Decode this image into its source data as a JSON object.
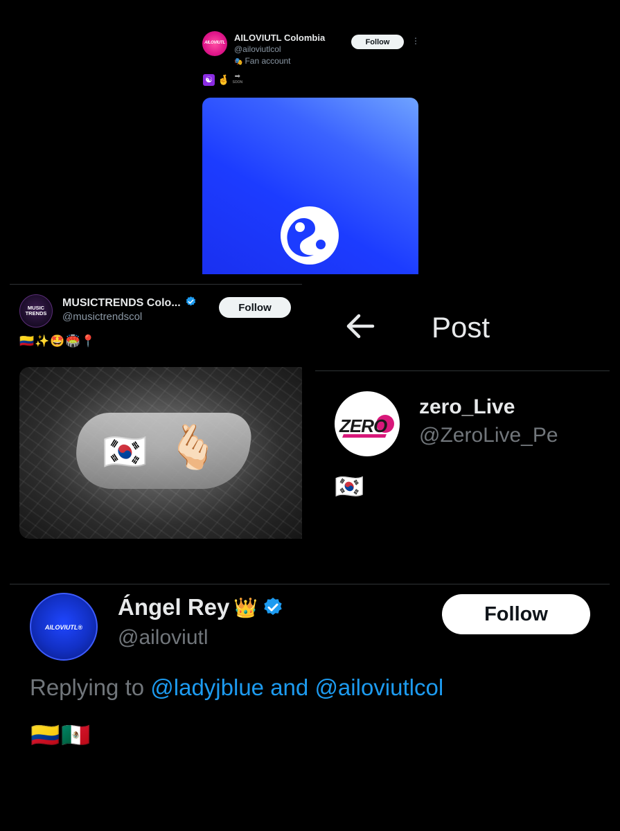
{
  "post_1": {
    "avatar_text": "AILOVIUTL",
    "display_name": "AILOVIUTL Colombia",
    "handle": "@ailoviutlcol",
    "label_icon": "fan-account-mask-icon",
    "label": "Fan account",
    "follow_label": "Follow",
    "more_icon": "⋮",
    "text_icons": [
      "yin-yang-icon",
      "crossed-fingers-icon",
      "soon-arrow-icon"
    ],
    "soon_text": "SOON",
    "media": {
      "description_colors": [
        "#6fa3ff",
        "#1c3cff"
      ],
      "icon": "yin-yang-icon"
    }
  },
  "post_2": {
    "avatar_text": "MUSIC TRENDS",
    "display_name": "MUSICTRENDS Colo...",
    "verified": true,
    "handle": "@musictrendscol",
    "follow_label": "Follow",
    "text": "🇨🇴✨🤩🏟️📍",
    "media_overlay": {
      "flag": "🇰🇷",
      "gesture": "🫰🏻"
    }
  },
  "post_3": {
    "header_title": "Post",
    "back_icon": "back-arrow-icon",
    "avatar_text": "ZERO",
    "display_name": "zero_Live",
    "handle": "@ZeroLive_Pe",
    "text": "🇰🇷"
  },
  "post_4": {
    "avatar_text": "AILOVIUTL®",
    "display_name": "Ángel Rey",
    "name_emoji": "👑",
    "verified": true,
    "handle": "@ailoviutl",
    "follow_label": "Follow",
    "replying_prefix": "Replying to ",
    "mention_1": "@ladyjblue",
    "conjunction": " and ",
    "mention_2": "@ailoviutlcol",
    "text": "🇨🇴🇲🇽"
  },
  "colors": {
    "background": "#000000",
    "text_primary": "#e7e9ea",
    "text_secondary": "#71767b",
    "link": "#1d9bf0",
    "verified": "#1d9bf0",
    "follow_bg": "#eff3f4"
  }
}
